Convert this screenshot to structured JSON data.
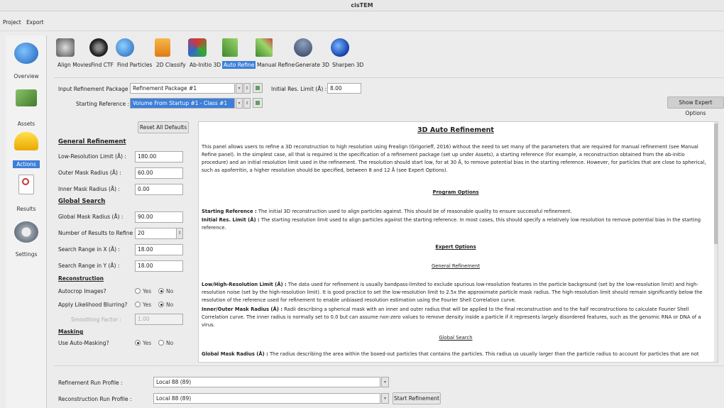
{
  "app": {
    "title": "cisTEM"
  },
  "menu": {
    "items": [
      "Project",
      "Export"
    ]
  },
  "sidebar": {
    "items": [
      {
        "label": "Overview",
        "icon": "globe-icon"
      },
      {
        "label": "Assets",
        "icon": "money-icon"
      },
      {
        "label": "Actions",
        "icon": "hardhat-icon",
        "selected": true
      },
      {
        "label": "Results",
        "icon": "checklist-icon"
      },
      {
        "label": "Settings",
        "icon": "gear-icon"
      }
    ]
  },
  "toolbar": {
    "items": [
      {
        "label": "Align Movies",
        "icon": "film-stack-icon"
      },
      {
        "label": "Find CTF",
        "icon": "lens-icon"
      },
      {
        "label": "Find Particles",
        "icon": "globe-icon"
      },
      {
        "label": "2D Classify",
        "icon": "hierarchy-icon"
      },
      {
        "label": "Ab-Initio 3D",
        "icon": "cube-icon"
      },
      {
        "label": "Auto Refine",
        "icon": "chart-icon",
        "active": true
      },
      {
        "label": "Manual Refine",
        "icon": "chart-tool-icon"
      },
      {
        "label": "Generate 3D",
        "icon": "reconstruct-icon"
      },
      {
        "label": "Sharpen 3D",
        "icon": "sphere-icon"
      }
    ]
  },
  "inputs": {
    "refinement_package_label": "Input Refinement Package :",
    "refinement_package_value": "Refinement Package #1",
    "starting_reference_label": "Starting Reference :",
    "starting_reference_value": "Volume From Startup #1 - Class #1",
    "initial_res_label": "Initial Res. Limit (Å) :",
    "initial_res_value": "8.00",
    "expert_button": "Show Expert Options"
  },
  "left_panel": {
    "reset_button": "Reset All Defaults",
    "general_title": "General Refinement",
    "low_res_label": "Low-Resolution Limit (Å) :",
    "low_res_value": "180.00",
    "outer_mask_label": "Outer Mask Radius (Å) :",
    "outer_mask_value": "60.00",
    "inner_mask_label": "Inner Mask Radius (Å) :",
    "inner_mask_value": "0.00",
    "global_title": "Global Search",
    "global_mask_label": "Global Mask Radius (Å) :",
    "global_mask_value": "90.00",
    "num_results_label": "Number of Results to Refine :",
    "num_results_value": "20",
    "range_x_label": "Search Range in X (Å) :",
    "range_x_value": "18.00",
    "range_y_label": "Search Range in Y (Å) :",
    "range_y_value": "18.00",
    "recon_title": "Reconstruction",
    "autocrop_label": "Autocrop Images?",
    "likelihood_label": "Apply Likelihood Blurring?",
    "smoothing_label": "Smoothing Factor :",
    "smoothing_value": "1.00",
    "masking_title": "Masking",
    "automask_label": "Use Auto-Masking?",
    "yes": "Yes",
    "no": "No"
  },
  "help": {
    "title": "3D Auto Refinement",
    "intro": "This panel allows users to refine a 3D reconstruction to high resolution using Frealign (Grigorieff, 2016) without the need to set many of the parameters that are required for manual refinement (see Manual Refine panel). In the simplest case, all that is required is the specification of a refinement package (set up under Assets), a starting reference (for example, a reconstruction obtained from the ab-initio procedure) and an initial resolution limit used in the refinement. The resolution should start low, for at 30 Å, to remove potential bias in the starting reference. However, for particles that are close to spherical, such as apoferritin, a higher resolution should be specified, between 8 and 12 Å (see Expert Options).",
    "program_options": "Program Options",
    "starting_ref_term": "Starting Reference :",
    "starting_ref_text": " The initial 3D reconstruction used to align particles against. This should be of reasonable quality to ensure successful refinement.",
    "initial_res_term": "Initial Res. Limit (Å) :",
    "initial_res_text": " The starting resolution limit used to align particles against the starting reference. In most cases, this should specify a relatively low resolution to remove potential bias in the starting reference.",
    "expert_options": "Expert Options",
    "general_refinement": "General Refinement",
    "lowhigh_term": "Low/High-Resolution Limit (Å) :",
    "lowhigh_text": " The data used for refinement is usually bandpass-limited to exclude spurious low-resolution features in the particle background (set by the low-resolution limit) and high-resolution noise (set by the high-resolution limit). It is good practice to set the low-resolution limit to 2.5x the approximate particle mask radius. The high-resolution limit should remain significantly below the resolution of the reference used for refinement to enable unbiased resolution estimation using the Fourier Shell Correlation curve.",
    "mask_term": "Inner/Outer Mask Radius (Å) :",
    "mask_text": " Radii describing a spherical mask with an inner and outer radius that will be applied to the final reconstruction and to the half reconstructions to calculate Fourier Shell Correlation curve. The inner radius is normally set to 0.0 but can assume non-zero values to remove density inside a particle if it represents largely disordered features, such as the genomic RNA or DNA of a virus.",
    "global_search": "Global Search",
    "global_term": "Global Mask Radius (Å) :",
    "global_text": " The radius describing the area within the boxed-out particles that contains the particles. This radius us usually larger than the particle radius to account for particles that are not"
  },
  "bottom": {
    "refinement_profile_label": "Refinement Run Profile :",
    "refinement_profile_value": "Local 88 (89)",
    "reconstruction_profile_label": "Reconstruction Run Profile :",
    "reconstruction_profile_value": "Local 88 (89)",
    "start_button": "Start Refinement"
  }
}
